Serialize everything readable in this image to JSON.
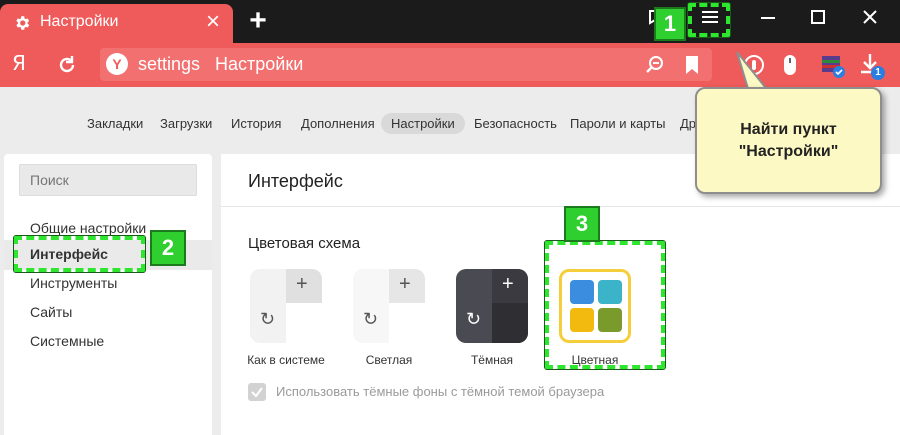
{
  "tab": {
    "title": "Настройки",
    "close": "×"
  },
  "new_tab": "+",
  "address_bar": {
    "logo": "Я",
    "host": "settings",
    "page_title": "Настройки"
  },
  "settings_nav": {
    "items": [
      "Закладки",
      "Загрузки",
      "История",
      "Дополнения",
      "Настройки",
      "Безопасность",
      "Пароли и карты",
      "Др"
    ],
    "active_index": 4
  },
  "sidebar": {
    "search_placeholder": "Поиск",
    "items": [
      "Общие настройки",
      "Интерфейс",
      "Инструменты",
      "Сайты",
      "Системные"
    ],
    "active_index": 1
  },
  "main": {
    "heading": "Интерфейс",
    "section_title": "Цветовая схема",
    "themes": [
      {
        "name": "Как в системе",
        "selected": false
      },
      {
        "name": "Светлая",
        "selected": false
      },
      {
        "name": "Тёмная",
        "selected": false
      },
      {
        "name": "Цветная",
        "selected": true
      }
    ],
    "dark_backgrounds_checkbox": {
      "label": "Использовать тёмные фоны с тёмной темой браузера",
      "checked": true,
      "disabled": true
    }
  },
  "downloads_badge": "1",
  "annotations": {
    "steps": [
      "1",
      "2",
      "3"
    ],
    "callout": [
      "Найти пункт",
      "\"Настройки\""
    ]
  },
  "colors": {
    "browser_accent": "#ef5a5a",
    "tab_strip": "#1b1b1b",
    "marker_green": "#2fe62f",
    "callout_bg": "#fdf9c4",
    "selected_theme_border": "#f5cf3b"
  }
}
